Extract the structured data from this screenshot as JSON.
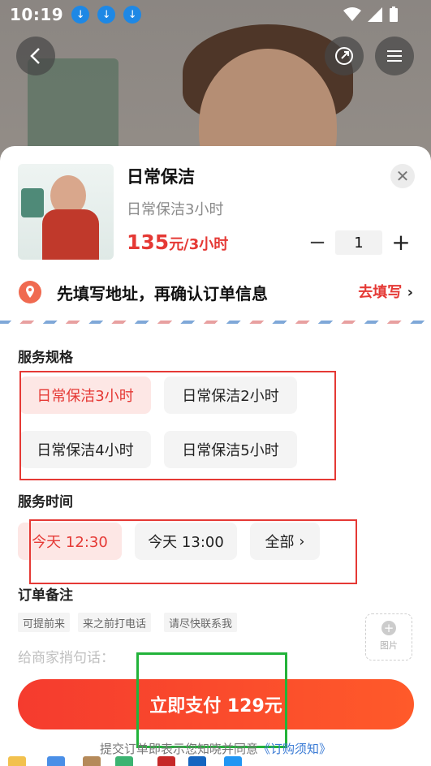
{
  "status_bar": {
    "time": "10:19"
  },
  "product": {
    "title": "日常保洁",
    "subtitle": "日常保洁3小时",
    "price": "135",
    "price_unit": "元/3小时",
    "quantity": "1"
  },
  "address": {
    "prompt": "先填写地址，再确认订单信息",
    "action": "去填写"
  },
  "spec": {
    "title": "服务规格",
    "options": [
      "日常保洁3小时",
      "日常保洁2小时",
      "日常保洁4小时",
      "日常保洁5小时"
    ],
    "selected": "日常保洁3小时"
  },
  "time": {
    "title": "服务时间",
    "options": [
      "今天 12:30",
      "今天 13:00",
      "全部"
    ],
    "selected": "今天 12:30"
  },
  "remark": {
    "title": "订单备注",
    "tags": [
      "可提前来",
      "来之前打电话",
      "请尽快联系我"
    ],
    "placeholder": "给商家捎句话：",
    "image_label": "图片"
  },
  "pay": {
    "label": "立即支付 129元"
  },
  "agreement": {
    "text": "提交订单即表示您知晓并同意",
    "link": "《订购须知》"
  },
  "colors": {
    "accent": "#e53935",
    "pay_gradient_start": "#f53b2e",
    "pay_gradient_end": "#ff5a2a",
    "highlight_red": "#e53935",
    "highlight_green": "#22b33a"
  }
}
